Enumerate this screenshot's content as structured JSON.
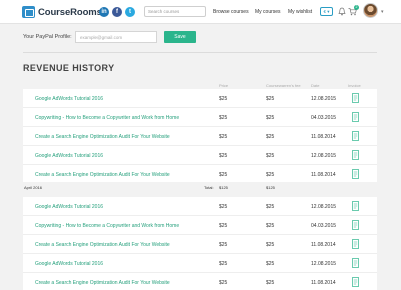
{
  "header": {
    "logo_text": "CourseRooms",
    "social": [
      "in",
      "f",
      "t"
    ],
    "search_placeholder": "Search courses",
    "nav": {
      "browse": "Browse courses",
      "my_courses": "My courses",
      "wishlist": "My wishlist"
    },
    "currency": "€ ▾",
    "cart_count": "2",
    "icons": [
      "linkedin-icon",
      "facebook-icon",
      "twitter-icon",
      "bell-icon",
      "cart-icon",
      "avatar",
      "chevron-down-icon"
    ]
  },
  "paypal": {
    "label": "Your PayPal Profile:",
    "placeholder": "example@gmail.com",
    "save_label": "Save"
  },
  "section_title": "REVENUE HISTORY",
  "columns": {
    "price": "Price",
    "fee": "Coursewarren's fee",
    "date": "Date",
    "invoice": "Invoice"
  },
  "group1": [
    {
      "title": "Google AdWords Tutorial 2016",
      "price": "$25",
      "fee": "$25",
      "date": "12.08.2015"
    },
    {
      "title": "Copywriting - How to Become a Copywriter and Work from Home",
      "price": "$25",
      "fee": "$25",
      "date": "04.03.2015"
    },
    {
      "title": "Create a Search Engine Optimization Audit For Your Website",
      "price": "$25",
      "fee": "$25",
      "date": "11.08.2014"
    },
    {
      "title": "Google AdWords Tutorial 2016",
      "price": "$25",
      "fee": "$25",
      "date": "12.08.2015"
    },
    {
      "title": "Create a Search Engine Optimization Audit For Your Website",
      "price": "$25",
      "fee": "$25",
      "date": "11.08.2014"
    }
  ],
  "summary": {
    "date": "April 2016",
    "total_label": "Total:",
    "price": "$125",
    "fee": "$125"
  },
  "group2": [
    {
      "title": "Google AdWords Tutorial 2016",
      "price": "$25",
      "fee": "$25",
      "date": "12.08.2015"
    },
    {
      "title": "Copywriting - How to Become a Copywriter and Work from Home",
      "price": "$25",
      "fee": "$25",
      "date": "04.03.2015"
    },
    {
      "title": "Create a Search Engine Optimization Audit For Your Website",
      "price": "$25",
      "fee": "$25",
      "date": "11.08.2014"
    },
    {
      "title": "Google AdWords Tutorial 2016",
      "price": "$25",
      "fee": "$25",
      "date": "12.08.2015"
    },
    {
      "title": "Create a Search Engine Optimization Audit For Your Website",
      "price": "$25",
      "fee": "$25",
      "date": "11.08.2014"
    }
  ]
}
